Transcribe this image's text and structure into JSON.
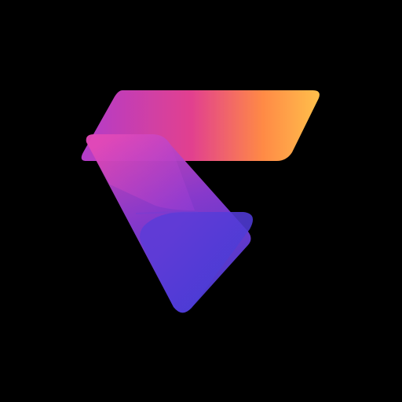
{
  "logo": {
    "icon": "abstract-f-logo-icon",
    "background_color": "#000000",
    "colors": {
      "magenta": "#C83FD0",
      "pink": "#E2418E",
      "orange": "#FF8A45",
      "yellow": "#FFC24C",
      "violet": "#7A35D8",
      "indigo": "#4A3CD6"
    }
  }
}
